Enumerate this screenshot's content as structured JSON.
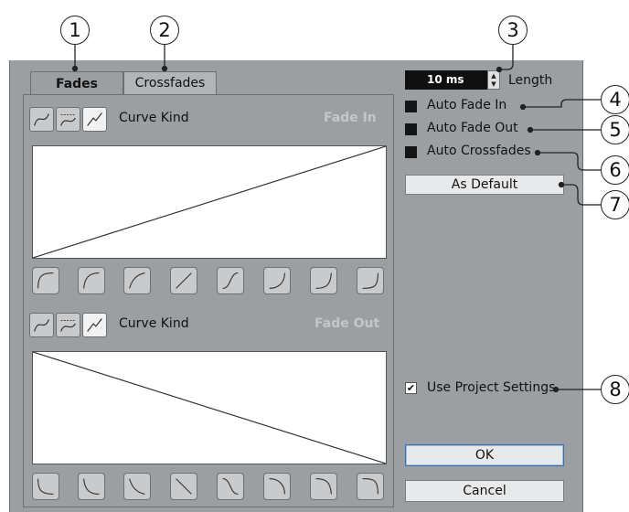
{
  "callouts": [
    "1",
    "2",
    "3",
    "4",
    "5",
    "6",
    "7",
    "8"
  ],
  "tabs": {
    "fades": "Fades",
    "crossfades": "Crossfades"
  },
  "fade_in": {
    "curve_kind_label": "Curve Kind",
    "title": "Fade In"
  },
  "fade_out": {
    "curve_kind_label": "Curve Kind",
    "title": "Fade Out"
  },
  "length": {
    "value": "10 ms",
    "label": "Length"
  },
  "auto_fade_in": {
    "label": "Auto Fade In",
    "checked": false
  },
  "auto_fade_out": {
    "label": "Auto Fade Out",
    "checked": false
  },
  "auto_crossfades": {
    "label": "Auto Crossfades",
    "checked": false
  },
  "as_default": {
    "label": "As Default"
  },
  "use_project_settings": {
    "label": "Use Project Settings",
    "checked": true,
    "check_mark": "✔"
  },
  "ok": {
    "label": "OK"
  },
  "cancel": {
    "label": "Cancel"
  }
}
